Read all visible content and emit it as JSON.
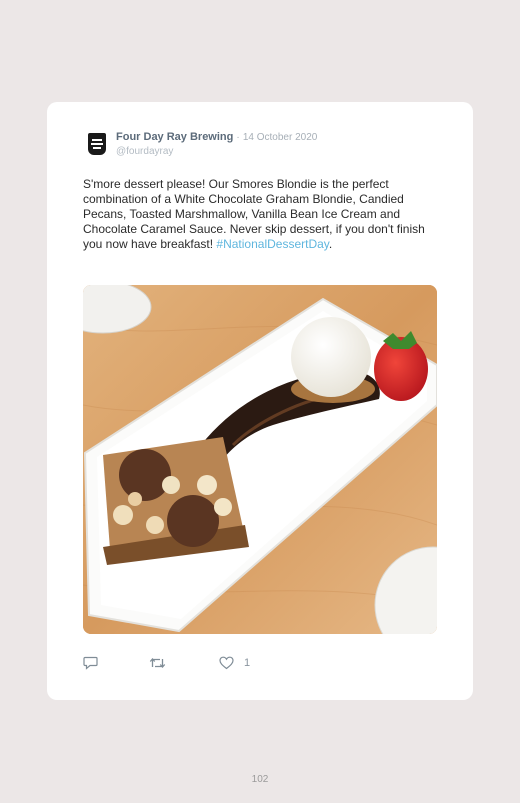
{
  "tweet": {
    "author_name": "Four Day Ray Brewing",
    "separator": "·",
    "date": "14 October 2020",
    "handle": "@fourdayray",
    "text": "S'more dessert please! Our Smores Blondie is the perfect combination of a White Chocolate Graham Blondie, Candied Pecans, Toasted Marshmallow, Vanilla Bean Ice Cream and Chocolate Caramel Sauce. Never skip dessert, if you don't finish you now have breakfast!",
    "hashtag": "#NationalDessertDay",
    "trailing": ".",
    "like_count": "1"
  },
  "icons": {
    "avatar": "brewery-logo-icon",
    "reply": "reply-icon",
    "retweet": "retweet-icon",
    "like": "heart-icon"
  },
  "colors": {
    "background": "#ece7e7",
    "card": "#ffffff",
    "name": "#5c6b7a",
    "hashtag": "#5fb6de"
  },
  "footer": {
    "page_number": "102"
  }
}
